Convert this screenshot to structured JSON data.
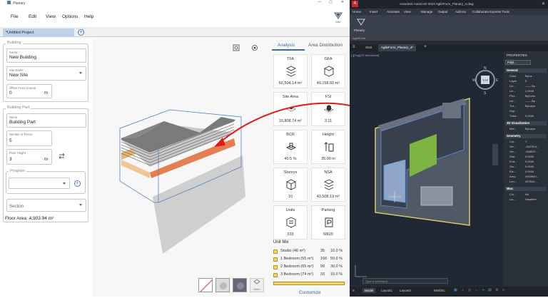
{
  "app": {
    "title": "Planary",
    "menu": [
      "File",
      "Edit",
      "View",
      "Options",
      "Help"
    ],
    "logo_text": "ADE",
    "tab_label": "*Untitled Project"
  },
  "building": {
    "section_label": "Building",
    "name_label": "Name",
    "name_value": "New Building",
    "site_label": "Site Name",
    "site_value": "New Site",
    "offset_label": "Offset From Ground",
    "offset_value": "0",
    "offset_unit": "m"
  },
  "building_part": {
    "section_label": "Building Part",
    "name_label": "Name",
    "name_value": "Building Part",
    "floors_label": "Number of Floors",
    "floors_value": "5",
    "height_label": "Floor Height",
    "height_value": "3",
    "height_unit": "m",
    "program_label": "Program",
    "section_field": "Section",
    "floor_area": "Floor Area: 4,903.94 m²"
  },
  "right_panel": {
    "tabs": [
      "Analysis",
      "Area Distribution"
    ],
    "tiles": [
      {
        "name": "TFA",
        "value": "56,504.14 m²",
        "icon": "floors-stack-icon"
      },
      {
        "name": "GFA",
        "value": "49,158.60 m²",
        "icon": "floors-outline-icon"
      },
      {
        "name": "Site Area",
        "value": "15,808.74 m²",
        "icon": "site-area-icon"
      },
      {
        "name": "FSI",
        "value": "3.11",
        "icon": "fsi-icon"
      },
      {
        "name": "BCR",
        "value": "40.5 %",
        "icon": "bcr-icon"
      },
      {
        "name": "Height",
        "value": "35.00 m",
        "icon": "height-icon"
      },
      {
        "name": "Storeys",
        "value": "10",
        "icon": "storeys-icon"
      },
      {
        "name": "NSA",
        "value": "43,508.19 m²",
        "icon": "nsa-icon"
      },
      {
        "name": "Units",
        "value": "333",
        "icon": "units-icon"
      },
      {
        "name": "Parking",
        "value": "680/0",
        "icon": "parking-icon"
      }
    ],
    "unit_mix_title": "Unit Mix",
    "unit_mix": [
      {
        "label": "Studio (46 m²)",
        "count": "35",
        "pct": "10.0 %"
      },
      {
        "label": "1 Bedroom (55 m²)",
        "count": "166",
        "pct": "50.0 %"
      },
      {
        "label": "2 Bedroom (65 m²)",
        "count": "99",
        "pct": "30.0 %"
      },
      {
        "label": "3 Bedroom (74 m²)",
        "count": "33",
        "pct": "10.0 %"
      }
    ],
    "customize_label": "Customize"
  },
  "viewport": {
    "more_label": "More"
  },
  "autocad": {
    "title": "Autodesk AutoCAD 2024    AgileForm_Planary_4.dwg",
    "menu": [
      "Home",
      "Insert",
      "Annotate",
      "View",
      "Manage",
      "Output",
      "Add-ins",
      "Collaborate",
      "Express Tools"
    ],
    "ribbon_label": "Planary",
    "ribbon_tab": "AgileForm",
    "doc_tabs": [
      "Start",
      "AgileForm_Planary_4*"
    ],
    "view_label": "[-][Top][2D Wireframe]",
    "compass": {
      "n": "N",
      "s": "S",
      "e": "E",
      "w": "W",
      "top": "TOP"
    },
    "cmd_placeholder": "Type a command",
    "status_tabs": [
      "Model",
      "Layout1",
      "Layout2"
    ],
    "model_label": "MODEL",
    "props_title": "PROPERTIES",
    "props_select": "Polyl...",
    "props": {
      "general_head": "General",
      "general": [
        [
          "Color",
          "ByLa..."
        ],
        [
          "Layer",
          "0"
        ],
        [
          "Lin...",
          "—— By..."
        ],
        [
          "Lin...",
          "1.0000"
        ],
        [
          "Plot...",
          "ByColor"
        ],
        [
          "Lin...",
          "—— By..."
        ],
        [
          "Tra...",
          "ByLayer"
        ],
        [
          "Hyp...",
          ""
        ],
        [
          "Thick...",
          "0.0000"
        ]
      ],
      "viz_head": "3D Visualization",
      "viz": [
        [
          "Mat...",
          "ByLayer"
        ]
      ],
      "geom_head": "Geometry",
      "geom": [
        [
          "Cur...",
          "1"
        ],
        [
          "Ver...",
          "-34278.6..."
        ],
        [
          "Ver...",
          "-548537..."
        ],
        [
          "Star...",
          "0.0000"
        ],
        [
          "End...",
          "0.0000"
        ],
        [
          "Glo...",
          "0.0000"
        ],
        [
          "Ele...",
          "0.0000"
        ],
        [
          "Area",
          "4903940..."
        ],
        [
          "Len...",
          "497843..."
        ]
      ],
      "misc_head": "Misc",
      "misc": [
        [
          "Clo...",
          "No"
        ],
        [
          "Lin...",
          "Disabled"
        ]
      ]
    }
  },
  "colors": {
    "accent": "#4a7ab8",
    "unit_mix": "#f3d56b",
    "arrow": "#e01b1b",
    "green": "#7cb342"
  }
}
